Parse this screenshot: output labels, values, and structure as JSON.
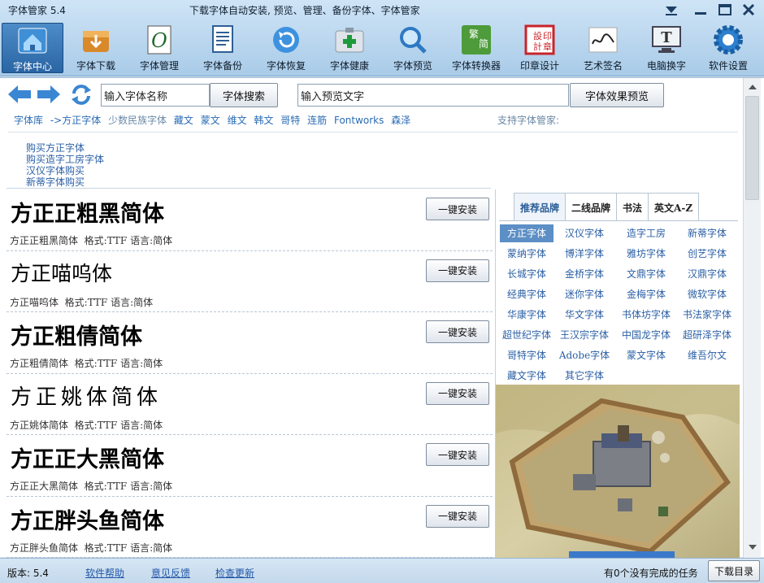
{
  "window": {
    "app_title": "字体管家 5.4",
    "subtitle": "下载字体自动安装, 预览、管理、备份字体、字体管家"
  },
  "toolbar": [
    {
      "label": "字体中心",
      "icon": "home-icon",
      "active": true
    },
    {
      "label": "字体下载",
      "icon": "download-box-icon"
    },
    {
      "label": "字体管理",
      "icon": "font-manage-icon"
    },
    {
      "label": "字体备份",
      "icon": "document-backup-icon"
    },
    {
      "label": "字体恢复",
      "icon": "restore-icon"
    },
    {
      "label": "字体健康",
      "icon": "first-aid-icon"
    },
    {
      "label": "字体预览",
      "icon": "magnifier-icon"
    },
    {
      "label": "字体转换器",
      "icon": "converter-icon"
    },
    {
      "label": "印章设计",
      "icon": "seal-icon"
    },
    {
      "label": "艺术签名",
      "icon": "signature-icon"
    },
    {
      "label": "电脑换字",
      "icon": "monitor-font-icon"
    },
    {
      "label": "软件设置",
      "icon": "gear-icon"
    }
  ],
  "search": {
    "font_name_value": "输入字体名称",
    "search_button": "字体搜索",
    "preview_value": "输入预览文字",
    "preview_button": "字体效果预览"
  },
  "breadcrumb": {
    "items": [
      "字体库",
      "->方正字体",
      "少数民族字体",
      "藏文",
      "蒙文",
      "维文",
      "韩文",
      "哥特",
      "连筋",
      "Fontworks",
      "森泽"
    ],
    "support_label": "支持字体管家:"
  },
  "buy_links": [
    "购买方正字体",
    "购买造字工房字体",
    "汉仪字体购买",
    "新蒂字体购买"
  ],
  "fonts": [
    {
      "preview": "方正正粗黑简体",
      "name": "方正正粗黑简体",
      "format_label": "格式:TTF",
      "lang_label": "语言:简体",
      "install": "一键安装"
    },
    {
      "preview": "方正喵呜体",
      "name": "方正喵呜体",
      "format_label": "格式:TTF",
      "lang_label": "语言:简体",
      "install": "一键安装"
    },
    {
      "preview": "方正粗倩简体",
      "name": "方正粗倩简体",
      "format_label": "格式:TTF",
      "lang_label": "语言:简体",
      "install": "一键安装"
    },
    {
      "preview": "方正姚体简体",
      "name": "方正姚体简体",
      "format_label": "格式:TTF",
      "lang_label": "语言:简体",
      "install": "一键安装"
    },
    {
      "preview": "方正正大黑简体",
      "name": "方正正大黑简体",
      "format_label": "格式:TTF",
      "lang_label": "语言:简体",
      "install": "一键安装"
    },
    {
      "preview": "方正胖头鱼简体",
      "name": "方正胖头鱼简体",
      "format_label": "格式:TTF",
      "lang_label": "语言:简体",
      "install": "一键安装"
    }
  ],
  "brand_tabs": [
    "推荐品牌",
    "二线品牌",
    "书法",
    "英文A-Z"
  ],
  "brands": [
    "方正字体",
    "汉仪字体",
    "造字工房",
    "新蒂字体",
    "蒙纳字体",
    "博洋字体",
    "雅坊字体",
    "创艺字体",
    "长城字体",
    "金桥字体",
    "文鼎字体",
    "汉鼎字体",
    "经典字体",
    "迷你字体",
    "金梅字体",
    "微软字体",
    "华康字体",
    "华文字体",
    "书体坊字体",
    "书法家字体",
    "超世纪字体",
    "王汉宗字体",
    "中国龙字体",
    "超研泽字体",
    "哥特字体",
    "Adobe字体",
    "蒙文字体",
    "维吾尔文",
    "藏文字体",
    "其它字体"
  ],
  "status": {
    "version": "版本: 5.4",
    "help": "软件帮助",
    "feedback": "意见反馈",
    "update": "检查更新",
    "tasks": "有0个没有完成的任务",
    "download_dir": "下载目录"
  },
  "colors": {
    "accent": "#2a65a4",
    "link": "#2a5fa5",
    "selected_brand": "#5b8fc5"
  }
}
